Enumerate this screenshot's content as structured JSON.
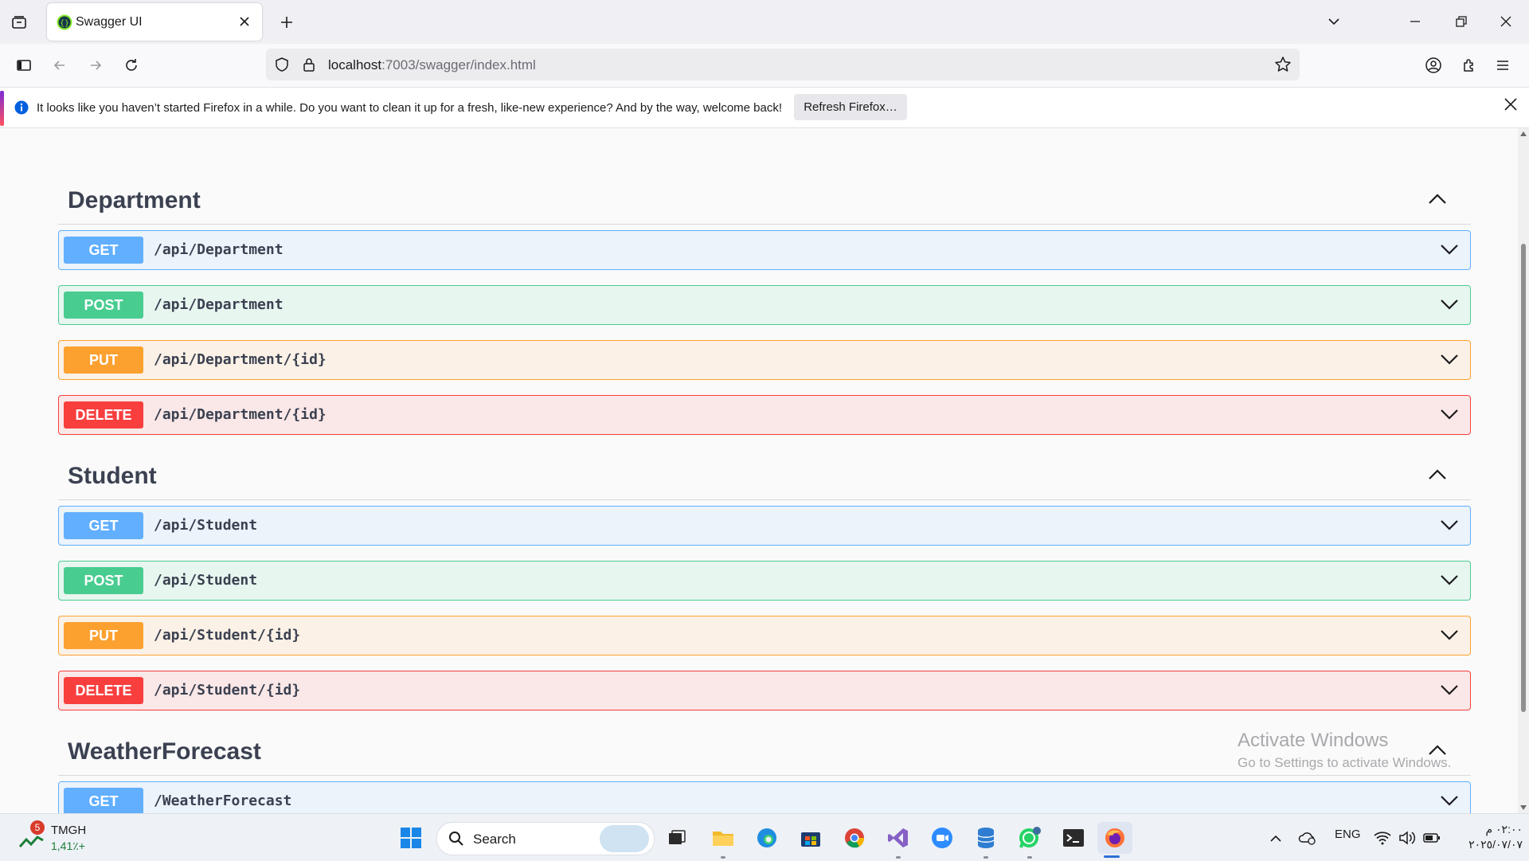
{
  "browser": {
    "tab_title": "Swagger UI",
    "url_host": "localhost",
    "url_rest": ":7003/swagger/index.html"
  },
  "notification": {
    "message": "It looks like you haven’t started Firefox in a while. Do you want to clean it up for a fresh, like-new experience? And by the way, welcome back!",
    "button": "Refresh Firefox…"
  },
  "groups": [
    {
      "name": "Department",
      "operations": [
        {
          "method": "GET",
          "path": "/api/Department"
        },
        {
          "method": "POST",
          "path": "/api/Department"
        },
        {
          "method": "PUT",
          "path": "/api/Department/{id}"
        },
        {
          "method": "DELETE",
          "path": "/api/Department/{id}"
        }
      ]
    },
    {
      "name": "Student",
      "operations": [
        {
          "method": "GET",
          "path": "/api/Student"
        },
        {
          "method": "POST",
          "path": "/api/Student"
        },
        {
          "method": "PUT",
          "path": "/api/Student/{id}"
        },
        {
          "method": "DELETE",
          "path": "/api/Student/{id}"
        }
      ]
    },
    {
      "name": "WeatherForecast",
      "operations": [
        {
          "method": "GET",
          "path": "/WeatherForecast"
        }
      ]
    }
  ],
  "watermark": {
    "line1": "Activate Windows",
    "line2": "Go to Settings to activate Windows."
  },
  "taskbar": {
    "ticker_badge": "5",
    "ticker_symbol": "TMGH",
    "ticker_change": "1,41٪+",
    "search_label": "Search",
    "language": "ENG",
    "time": "٠٢:٠٠ م",
    "date": "٢٠٢٥/٠٧/٠٧"
  },
  "colors": {
    "get": "#61affe",
    "post": "#49cc90",
    "put": "#fca130",
    "delete": "#f93e3e"
  }
}
